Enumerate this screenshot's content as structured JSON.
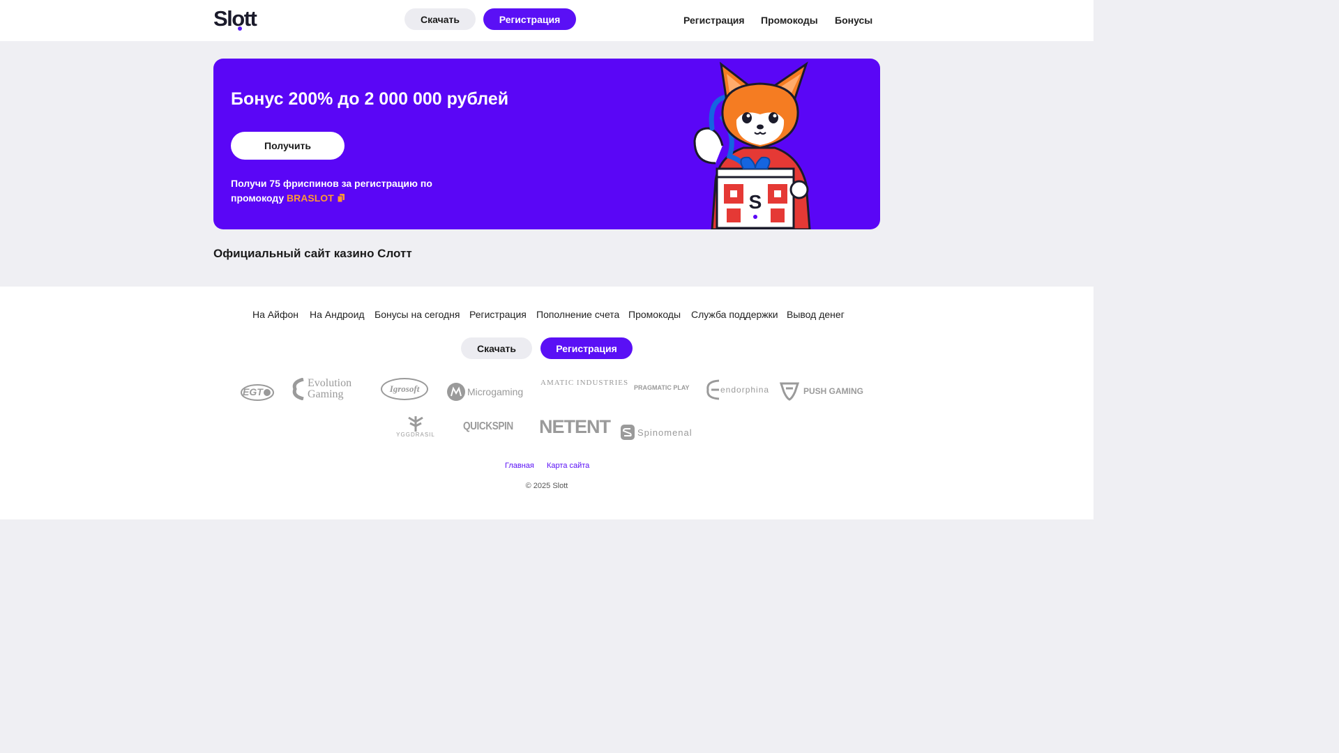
{
  "header": {
    "logo": "Slott",
    "download_label": "Скачать",
    "register_label": "Регистрация",
    "nav": [
      "Регистрация",
      "Промокоды",
      "Бонусы"
    ]
  },
  "banner": {
    "title": "Бонус 200% до 2 000 000 рублей",
    "cta_label": "Получить",
    "text_part1": "Получи 75 фриспинов за регистрацию по промокоду",
    "promo_code": "BRASLOT",
    "background_color": "#5a06f6",
    "promo_color": "#ff9933",
    "mascot_icon": "fox-mascot-icon"
  },
  "main": {
    "section_title": "Официальный сайт казино Слотт"
  },
  "footer": {
    "nav": [
      "На Айфон",
      "На Андроид",
      "Бонусы на сегодня",
      "Регистрация",
      "Пополнение счета",
      "Промокоды",
      "Служба поддержки",
      "Вывод денег"
    ],
    "download_label": "Скачать",
    "register_label": "Регистрация",
    "providers": [
      "EGT",
      "Evolution Gaming",
      "Igrosoft",
      "Microgaming",
      "AMATIC INDUSTRIES",
      "PRAGMATIC PLAY",
      "endorphina",
      "PUSH GAMING",
      "YGGDRASIL",
      "QUICKSPIN",
      "NETENT",
      "Spinomenal"
    ],
    "links": [
      "Главная",
      "Карта сайта"
    ],
    "copyright": "© 2025 Slott"
  },
  "colors": {
    "accent": "#5a10f5",
    "page_background": "#efeff3",
    "gray_button": "#ececf1"
  }
}
